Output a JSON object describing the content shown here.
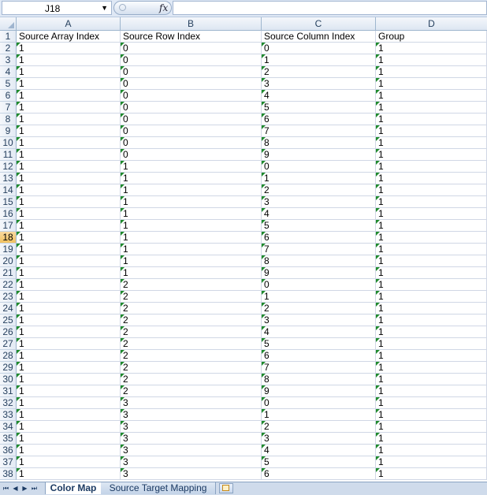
{
  "name_box": {
    "value": "J18",
    "arrow": "▼"
  },
  "formula_bar": {
    "fx_label": "fx",
    "value": ""
  },
  "columns": [
    "A",
    "B",
    "C",
    "D"
  ],
  "selected_row": 18,
  "rows": [
    [
      "1",
      "Source Array Index",
      "Source Row Index",
      "Source Column Index",
      "Group"
    ],
    [
      "2",
      "1",
      "0",
      "0",
      "1"
    ],
    [
      "3",
      "1",
      "0",
      "1",
      "1"
    ],
    [
      "4",
      "1",
      "0",
      "2",
      "1"
    ],
    [
      "5",
      "1",
      "0",
      "3",
      "1"
    ],
    [
      "6",
      "1",
      "0",
      "4",
      "1"
    ],
    [
      "7",
      "1",
      "0",
      "5",
      "1"
    ],
    [
      "8",
      "1",
      "0",
      "6",
      "1"
    ],
    [
      "9",
      "1",
      "0",
      "7",
      "1"
    ],
    [
      "10",
      "1",
      "0",
      "8",
      "1"
    ],
    [
      "11",
      "1",
      "0",
      "9",
      "1"
    ],
    [
      "12",
      "1",
      "1",
      "0",
      "1"
    ],
    [
      "13",
      "1",
      "1",
      "1",
      "1"
    ],
    [
      "14",
      "1",
      "1",
      "2",
      "1"
    ],
    [
      "15",
      "1",
      "1",
      "3",
      "1"
    ],
    [
      "16",
      "1",
      "1",
      "4",
      "1"
    ],
    [
      "17",
      "1",
      "1",
      "5",
      "1"
    ],
    [
      "18",
      "1",
      "1",
      "6",
      "1"
    ],
    [
      "19",
      "1",
      "1",
      "7",
      "1"
    ],
    [
      "20",
      "1",
      "1",
      "8",
      "1"
    ],
    [
      "21",
      "1",
      "1",
      "9",
      "1"
    ],
    [
      "22",
      "1",
      "2",
      "0",
      "1"
    ],
    [
      "23",
      "1",
      "2",
      "1",
      "1"
    ],
    [
      "24",
      "1",
      "2",
      "2",
      "1"
    ],
    [
      "25",
      "1",
      "2",
      "3",
      "1"
    ],
    [
      "26",
      "1",
      "2",
      "4",
      "1"
    ],
    [
      "27",
      "1",
      "2",
      "5",
      "1"
    ],
    [
      "28",
      "1",
      "2",
      "6",
      "1"
    ],
    [
      "29",
      "1",
      "2",
      "7",
      "1"
    ],
    [
      "30",
      "1",
      "2",
      "8",
      "1"
    ],
    [
      "31",
      "1",
      "2",
      "9",
      "1"
    ],
    [
      "32",
      "1",
      "3",
      "0",
      "1"
    ],
    [
      "33",
      "1",
      "3",
      "1",
      "1"
    ],
    [
      "34",
      "1",
      "3",
      "2",
      "1"
    ],
    [
      "35",
      "1",
      "3",
      "3",
      "1"
    ],
    [
      "36",
      "1",
      "3",
      "4",
      "1"
    ],
    [
      "37",
      "1",
      "3",
      "5",
      "1"
    ],
    [
      "38",
      "1",
      "3",
      "6",
      "1"
    ]
  ],
  "sheet_tabs": {
    "nav": [
      "⏮",
      "◀",
      "▶",
      "⏭"
    ],
    "tabs": [
      {
        "label": "Color Map",
        "active": true
      },
      {
        "label": "Source Target Mapping",
        "active": false
      }
    ]
  },
  "colors": {
    "accent": "#1b3a63",
    "error_triangle": "#1f8a2d",
    "selected_row_header": "#f1c15f"
  }
}
